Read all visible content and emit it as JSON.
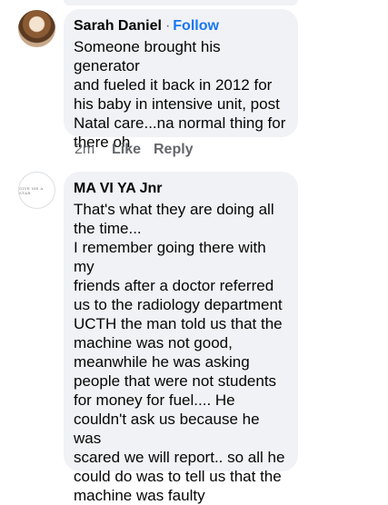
{
  "comments": [
    {
      "author": "Sarah Daniel",
      "separator": "·",
      "follow_label": "Follow",
      "text": "Someone brought his generator\nand fueled it back in 2012 for\nhis baby in intensive unit, post\nNatal care...na normal thing for\nthere oh",
      "time": "2m",
      "like_label": "Like",
      "reply_label": "Reply"
    },
    {
      "author": "MA VI YA Jnr",
      "avatar_text": "GIVE ME A STAR",
      "text": "That's what they are doing all\nthe time...\nI remember going there with my\nfriends after a doctor referred\nus to the radiology department\nUCTH the man told us that the\nmachine was not good,\nmeanwhile he was asking\npeople that were not students\nfor money for fuel.... He\ncouldn't ask us because he was\nscared we will report.. so all he\ncould do was to tell us that the\nmachine was faulty"
    }
  ],
  "colors": {
    "bubble": "#f0f2f5",
    "link": "#1877f2",
    "secondary_text": "#65676b"
  }
}
